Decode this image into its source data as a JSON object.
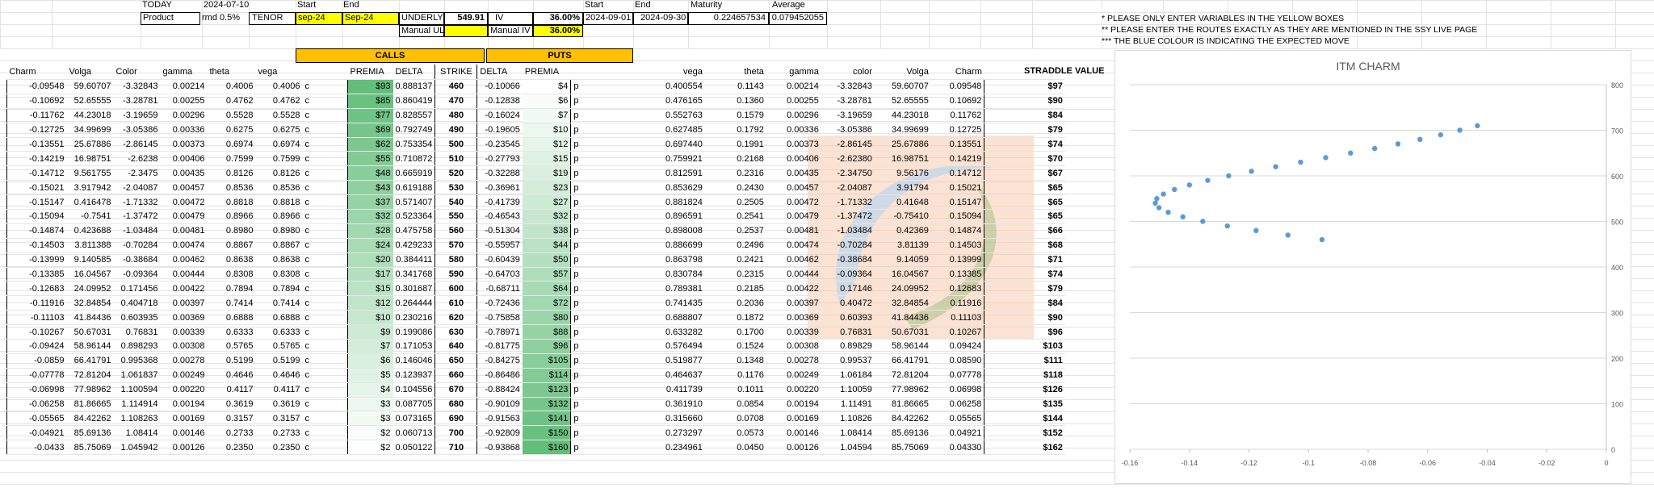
{
  "top": {
    "today_label": "TODAY",
    "today_value": "2024-07-10",
    "product_label": "Product",
    "product_value": "rmd 0.5%",
    "tenor_label": "TENOR",
    "start_label": "Start",
    "end_label": "End",
    "start_value": "sep-24",
    "end_value": "Sep-24",
    "underlying_label": "UNDERLYI",
    "underlying_value": "549.91",
    "manual_ul_label": "Manual UL",
    "iv_label": "IV",
    "iv_value": "36.00%",
    "manual_iv_label": "Manual IV",
    "manual_iv_value": "36.00%",
    "start2_label": "Start",
    "start2_value": "2024-09-01",
    "end2_label": "End",
    "end2_value": "2024-09-30",
    "maturity_label": "Maturity",
    "maturity_value": "0.224657534",
    "average_label": "Average",
    "average_value": "0.079452055"
  },
  "notes": [
    "* PLEASE ONLY ENTER VARIABLES IN THE YELLOW BOXES",
    "** PLEASE ENTER THE ROUTES EXACTLY AS THEY ARE MENTIONED IN THE SSY LIVE PAGE",
    "*** THE BLUE COLOUR IS INDICATING THE EXPECTED MOVE"
  ],
  "headers": {
    "calls": "CALLS",
    "puts": "PUTS",
    "straddle": "STRADDLE VALUE",
    "left": [
      "Charm",
      "Volga",
      "Color",
      "gamma",
      "theta",
      "vega",
      "",
      "PREMIA",
      "DELTA",
      "STRIKE",
      "DELTA",
      "PREMIA",
      "",
      "vega",
      "theta",
      "gamma",
      "color",
      "Volga",
      "Charm"
    ]
  },
  "rows": [
    [
      "-0.09548",
      "59.60707",
      "-3.32843",
      "0.00214",
      "0.4006",
      "0.4006",
      "c",
      "$93",
      "0.888137",
      "460",
      "-0.10066",
      "$4",
      "p",
      "0.400554",
      "0.1143",
      "0.00214",
      "-3.32843",
      "59.60707",
      "0.09548",
      "$97"
    ],
    [
      "-0.10692",
      "52.65555",
      "-3.28781",
      "0.00255",
      "0.4762",
      "0.4762",
      "c",
      "$85",
      "0.860419",
      "470",
      "-0.12838",
      "$6",
      "p",
      "0.476165",
      "0.1360",
      "0.00255",
      "-3.28781",
      "52.65555",
      "0.10692",
      "$90"
    ],
    [
      "-0.11762",
      "44.23018",
      "-3.19659",
      "0.00296",
      "0.5528",
      "0.5528",
      "c",
      "$77",
      "0.828557",
      "480",
      "-0.16024",
      "$7",
      "p",
      "0.552763",
      "0.1579",
      "0.00296",
      "-3.19659",
      "44.23018",
      "0.11762",
      "$84"
    ],
    [
      "-0.12725",
      "34.99699",
      "-3.05386",
      "0.00336",
      "0.6275",
      "0.6275",
      "c",
      "$69",
      "0.792749",
      "490",
      "-0.19605",
      "$10",
      "p",
      "0.627485",
      "0.1792",
      "0.00336",
      "-3.05386",
      "34.99699",
      "0.12725",
      "$79"
    ],
    [
      "-0.13551",
      "25.67886",
      "-2.86145",
      "0.00373",
      "0.6974",
      "0.6974",
      "c",
      "$62",
      "0.753354",
      "500",
      "-0.23545",
      "$12",
      "p",
      "0.697440",
      "0.1991",
      "0.00373",
      "-2.86145",
      "25.67886",
      "0.13551",
      "$74"
    ],
    [
      "-0.14219",
      "16.98751",
      "-2.6238",
      "0.00406",
      "0.7599",
      "0.7599",
      "c",
      "$55",
      "0.710872",
      "510",
      "-0.27793",
      "$15",
      "p",
      "0.759921",
      "0.2168",
      "0.00406",
      "-2.62380",
      "16.98751",
      "0.14219",
      "$70"
    ],
    [
      "-0.14712",
      "9.561755",
      "-2.3475",
      "0.00435",
      "0.8126",
      "0.8126",
      "c",
      "$48",
      "0.665919",
      "520",
      "-0.32288",
      "$19",
      "p",
      "0.812591",
      "0.2316",
      "0.00435",
      "-2.34750",
      "9.56176",
      "0.14712",
      "$67"
    ],
    [
      "-0.15021",
      "3.917942",
      "-2.04087",
      "0.00457",
      "0.8536",
      "0.8536",
      "c",
      "$43",
      "0.619188",
      "530",
      "-0.36961",
      "$23",
      "p",
      "0.853629",
      "0.2430",
      "0.00457",
      "-2.04087",
      "3.91794",
      "0.15021",
      "$65"
    ],
    [
      "-0.15147",
      "0.416478",
      "-1.71332",
      "0.00472",
      "0.8818",
      "0.8818",
      "c",
      "$37",
      "0.571407",
      "540",
      "-0.41739",
      "$27",
      "p",
      "0.881824",
      "0.2505",
      "0.00472",
      "-1.71332",
      "0.41648",
      "0.15147",
      "$65"
    ],
    [
      "-0.15094",
      "-0.7541",
      "-1.37472",
      "0.00479",
      "0.8966",
      "0.8966",
      "c",
      "$32",
      "0.523364",
      "550",
      "-0.46543",
      "$32",
      "p",
      "0.896591",
      "0.2541",
      "0.00479",
      "-1.37472",
      "-0.75410",
      "0.15094",
      "$65"
    ],
    [
      "-0.14874",
      "0.423688",
      "-1.03484",
      "0.00481",
      "0.8980",
      "0.8980",
      "c",
      "$28",
      "0.475758",
      "560",
      "-0.51304",
      "$38",
      "p",
      "0.898008",
      "0.2537",
      "0.00481",
      "-1.03484",
      "0.42369",
      "0.14874",
      "$66"
    ],
    [
      "-0.14503",
      "3.811388",
      "-0.70284",
      "0.00474",
      "0.8867",
      "0.8867",
      "c",
      "$24",
      "0.429233",
      "570",
      "-0.55957",
      "$44",
      "p",
      "0.886699",
      "0.2496",
      "0.00474",
      "-0.70284",
      "3.81139",
      "0.14503",
      "$68"
    ],
    [
      "-0.13999",
      "9.140585",
      "-0.38684",
      "0.00462",
      "0.8638",
      "0.8638",
      "c",
      "$20",
      "0.384411",
      "580",
      "-0.60439",
      "$50",
      "p",
      "0.863798",
      "0.2421",
      "0.00462",
      "-0.38684",
      "9.14059",
      "0.13999",
      "$71"
    ],
    [
      "-0.13385",
      "16.04567",
      "-0.09364",
      "0.00444",
      "0.8308",
      "0.8308",
      "c",
      "$17",
      "0.341768",
      "590",
      "-0.64703",
      "$57",
      "p",
      "0.830784",
      "0.2315",
      "0.00444",
      "-0.09364",
      "16.04567",
      "0.13385",
      "$74"
    ],
    [
      "-0.12683",
      "24.09952",
      "0.171456",
      "0.00422",
      "0.7894",
      "0.7894",
      "c",
      "$15",
      "0.301687",
      "600",
      "-0.68711",
      "$64",
      "p",
      "0.789381",
      "0.2185",
      "0.00422",
      "0.17146",
      "24.09952",
      "0.12683",
      "$79"
    ],
    [
      "-0.11916",
      "32.84854",
      "0.404718",
      "0.00397",
      "0.7414",
      "0.7414",
      "c",
      "$12",
      "0.264444",
      "610",
      "-0.72436",
      "$72",
      "p",
      "0.741435",
      "0.2036",
      "0.00397",
      "0.40472",
      "32.84854",
      "0.11916",
      "$84"
    ],
    [
      "-0.11103",
      "41.84436",
      "0.603935",
      "0.00369",
      "0.6888",
      "0.6888",
      "c",
      "$10",
      "0.230216",
      "620",
      "-0.75858",
      "$80",
      "p",
      "0.688807",
      "0.1872",
      "0.00369",
      "0.60393",
      "41.84436",
      "0.11103",
      "$90"
    ],
    [
      "-0.10267",
      "50.67031",
      "0.76831",
      "0.00339",
      "0.6333",
      "0.6333",
      "c",
      "$9",
      "0.199086",
      "630",
      "-0.78971",
      "$88",
      "p",
      "0.633282",
      "0.1700",
      "0.00339",
      "0.76831",
      "50.67031",
      "0.10267",
      "$96"
    ],
    [
      "-0.09424",
      "58.96144",
      "0.898293",
      "0.00308",
      "0.5765",
      "0.5765",
      "c",
      "$7",
      "0.171053",
      "640",
      "-0.81775",
      "$96",
      "p",
      "0.576494",
      "0.1524",
      "0.00308",
      "0.89829",
      "58.96144",
      "0.09424",
      "$103"
    ],
    [
      "-0.0859",
      "66.41791",
      "0.995368",
      "0.00278",
      "0.5199",
      "0.5199",
      "c",
      "$6",
      "0.146046",
      "650",
      "-0.84275",
      "$105",
      "p",
      "0.519877",
      "0.1348",
      "0.00278",
      "0.99537",
      "66.41791",
      "0.08590",
      "$111"
    ],
    [
      "-0.07778",
      "72.81204",
      "1.061837",
      "0.00249",
      "0.4646",
      "0.4646",
      "c",
      "$5",
      "0.123937",
      "660",
      "-0.86486",
      "$114",
      "p",
      "0.464637",
      "0.1176",
      "0.00249",
      "1.06184",
      "72.81204",
      "0.07778",
      "$118"
    ],
    [
      "-0.06998",
      "77.98962",
      "1.100594",
      "0.00220",
      "0.4117",
      "0.4117",
      "c",
      "$4",
      "0.104556",
      "670",
      "-0.88424",
      "$123",
      "p",
      "0.411739",
      "0.1011",
      "0.00220",
      "1.10059",
      "77.98962",
      "0.06998",
      "$126"
    ],
    [
      "-0.06258",
      "81.86665",
      "1.114914",
      "0.00194",
      "0.3619",
      "0.3619",
      "c",
      "$3",
      "0.087705",
      "680",
      "-0.90109",
      "$132",
      "p",
      "0.361910",
      "0.0854",
      "0.00194",
      "1.11491",
      "81.86665",
      "0.06258",
      "$135"
    ],
    [
      "-0.05565",
      "84.42262",
      "1.108263",
      "0.00169",
      "0.3157",
      "0.3157",
      "c",
      "$3",
      "0.073165",
      "690",
      "-0.91563",
      "$141",
      "p",
      "0.315660",
      "0.0708",
      "0.00169",
      "1.10826",
      "84.42262",
      "0.05565",
      "$144"
    ],
    [
      "-0.04921",
      "85.69136",
      "1.08414",
      "0.00146",
      "0.2733",
      "0.2733",
      "c",
      "$2",
      "0.060713",
      "700",
      "-0.92809",
      "$150",
      "p",
      "0.273297",
      "0.0573",
      "0.00146",
      "1.08414",
      "85.69136",
      "0.04921",
      "$152"
    ],
    [
      "-0.0433",
      "85.75069",
      "1.045942",
      "0.00126",
      "0.2350",
      "0.2350",
      "c",
      "$2",
      "0.050122",
      "710",
      "-0.93868",
      "$160",
      "p",
      "0.234961",
      "0.0450",
      "0.00126",
      "1.04594",
      "85.75069",
      "0.04330",
      "$162"
    ]
  ],
  "colors": {
    "yellow": "#ffff00",
    "orange": "#ffc000",
    "green_dark": "#63be7b",
    "green_light": "#ffffff",
    "scatter": "#5b9bd5",
    "expected_move_orange": "#f8cbad",
    "expected_move_blue": "#bdd7ee"
  },
  "chart_data": {
    "type": "scatter",
    "title": "ITM CHARM",
    "xlabel": "",
    "ylabel": "",
    "xlim": [
      -0.16,
      0
    ],
    "ylim": [
      0,
      800
    ],
    "x_ticks": [
      "-0.16",
      "-0.14",
      "-0.12",
      "-0.1",
      "-0.08",
      "-0.06",
      "-0.04",
      "-0.02",
      "0"
    ],
    "y_ticks": [
      "0",
      "100",
      "200",
      "300",
      "400",
      "500",
      "600",
      "700",
      "800"
    ],
    "grid": true,
    "series": [
      {
        "points": [
          [
            -0.09548,
            460
          ],
          [
            -0.10692,
            470
          ],
          [
            -0.11762,
            480
          ],
          [
            -0.12725,
            490
          ],
          [
            -0.13551,
            500
          ],
          [
            -0.14219,
            510
          ],
          [
            -0.14712,
            520
          ],
          [
            -0.15021,
            530
          ],
          [
            -0.15147,
            540
          ],
          [
            -0.15094,
            550
          ],
          [
            -0.14874,
            560
          ],
          [
            -0.14503,
            570
          ],
          [
            -0.13999,
            580
          ],
          [
            -0.13385,
            590
          ],
          [
            -0.12683,
            600
          ],
          [
            -0.11916,
            610
          ],
          [
            -0.11103,
            620
          ],
          [
            -0.10267,
            630
          ],
          [
            -0.09424,
            640
          ],
          [
            -0.0859,
            650
          ],
          [
            -0.07778,
            660
          ],
          [
            -0.06998,
            670
          ],
          [
            -0.06258,
            680
          ],
          [
            -0.05565,
            690
          ],
          [
            -0.04921,
            700
          ],
          [
            -0.0433,
            710
          ]
        ]
      }
    ]
  }
}
